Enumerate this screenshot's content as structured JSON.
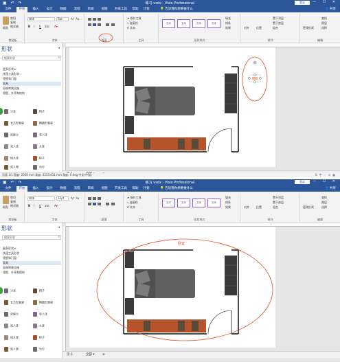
{
  "window": {
    "title": "练习.vsdx - Visio Professional",
    "login_label": "登录",
    "share_label": "共享",
    "qat_icons": [
      "save-icon",
      "undo-icon",
      "redo-icon"
    ]
  },
  "tabs": [
    "文件",
    "开始",
    "插入",
    "设计",
    "数据",
    "流程",
    "审阅",
    "视图",
    "开发工具",
    "帮助",
    "计划"
  ],
  "tell_me": "告诉我你想要做什么",
  "ribbon": {
    "clipboard": {
      "paste": "粘贴",
      "cut": "剪切",
      "copy": "复制",
      "format_painter": "格式刷",
      "label": "剪贴板"
    },
    "font": {
      "name": "宋体",
      "size1": "6pt",
      "size2": "12pt",
      "label": "字体"
    },
    "paragraph": {
      "label": "段落"
    },
    "tools": {
      "pointer": "指针工具",
      "connector": "连接线",
      "text": "文本",
      "label": "工具"
    },
    "shape_styles": {
      "style_label": "文本",
      "label": "形状样式",
      "fill": "填充",
      "line": "线条",
      "effects": "效果"
    },
    "arrange": {
      "align": "对齐",
      "position": "位置",
      "bring_front": "置于顶层",
      "send_back": "置于底层",
      "group": "组合",
      "label": "排列"
    },
    "editing": {
      "change_shape": "更改形状",
      "find": "查找",
      "layers": "图层",
      "select": "选择",
      "label": "编辑"
    }
  },
  "shapes_panel": {
    "title": "形状",
    "search_placeholder": "搜索形状",
    "categories": [
      "更多形状",
      "快速工具形状",
      "墙壁和门窗",
      "家具",
      "园林附属设施",
      "墙壁、外壳和结构"
    ],
    "stencils": [
      {
        "name": "沙发",
        "color": "#6d6d6d"
      },
      {
        "name": "椅子",
        "color": "#5c4a3a"
      },
      {
        "name": "长方形餐桌",
        "color": "#7b5a3c"
      },
      {
        "name": "椭圆形餐桌",
        "color": "#8b6a4a"
      },
      {
        "name": "双座沙",
        "color": "#6b6b6b"
      },
      {
        "name": "单人床",
        "color": "#7a6a86"
      },
      {
        "name": "双人床",
        "color": "#8b8b8b"
      },
      {
        "name": "大床",
        "color": "#8a7a94"
      },
      {
        "name": "组大床",
        "color": "#9a8a7a"
      },
      {
        "name": "柜子",
        "color": "#a0522d"
      },
      {
        "name": "双人椅",
        "color": "#7a5a3a"
      },
      {
        "name": "台灯",
        "color": "#6a6a6a"
      }
    ]
  },
  "sheet_tabs": {
    "page": "页-1",
    "all": "全部"
  },
  "status": {
    "text": "页面 1/1   宽度: 2059 mm   高度: 4333.611 mm   角度: 0 deg   中文(中国)"
  },
  "annotations": {
    "room_label": "卧室"
  },
  "colors": {
    "brand": "#2b579a",
    "annotation": "#e6512b"
  }
}
